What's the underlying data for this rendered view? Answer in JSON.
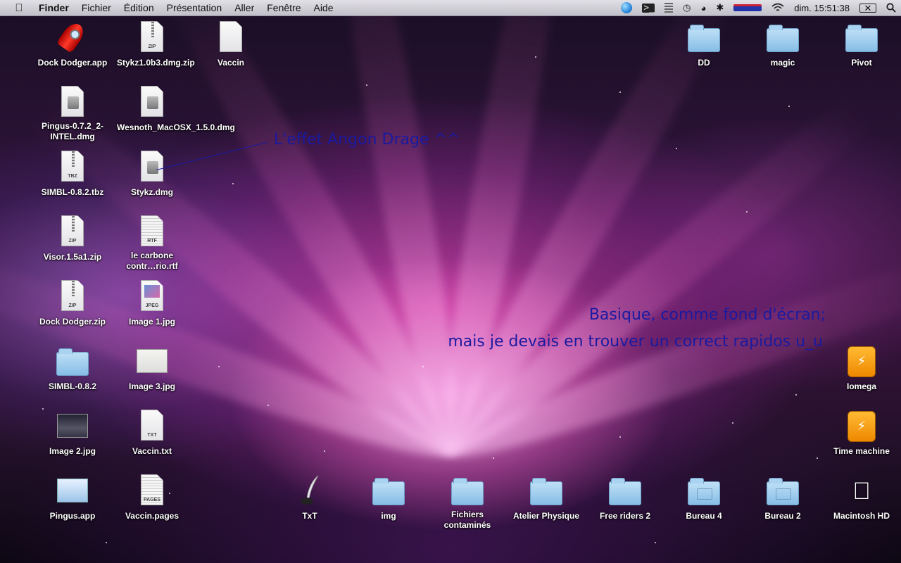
{
  "menubar": {
    "app": "Finder",
    "menus": [
      "Fichier",
      "Édition",
      "Présentation",
      "Aller",
      "Fenêtre",
      "Aide"
    ],
    "clock": "dim. 15:51:38",
    "icons": [
      "globe-icon",
      "terminal-icon",
      "bars-icon",
      "time-machine-icon",
      "palette-icon",
      "bluetooth-icon",
      "flag-icon",
      "wifi-icon",
      "battery-icon",
      "spotlight-icon"
    ]
  },
  "icons": {
    "dock_dodger_app": "Dock Dodger.app",
    "stykz_zip": "Stykz1.0b3.dmg.zip",
    "vaccin": "Vaccin",
    "pingus_dmg": "Pingus-0.7.2_2-INTEL.dmg",
    "wesnoth_dmg": "Wesnoth_MacOSX_1.5.0.dmg",
    "simbl_tbz": "SIMBL-0.8.2.tbz",
    "stykz_dmg": "Stykz.dmg",
    "visor_zip": "Visor.1.5a1.zip",
    "carbone_rtf": "le carbone contr…rio.rtf",
    "dock_dodger_zip": "Dock Dodger.zip",
    "image1": "Image 1.jpg",
    "simbl_folder": "SIMBL-0.8.2",
    "image3": "Image 3.jpg",
    "image2": "Image 2.jpg",
    "vaccin_txt": "Vaccin.txt",
    "pingus_app": "Pingus.app",
    "vaccin_pages": "Vaccin.pages",
    "dd": "DD",
    "magic": "magic",
    "pivot": "Pivot",
    "iomega": "Iomega",
    "time_machine": "Time machine",
    "macintosh_hd": "Macintosh HD",
    "txt": "TxT",
    "img": "img",
    "fichiers": "Fichiers contaminés",
    "atelier": "Atelier Physique",
    "free_riders": "Free riders 2",
    "bureau4": "Bureau 4",
    "bureau2": "Bureau 2"
  },
  "annotations": {
    "angon": "L'effet Angon Drage ^^",
    "basique": "Basique, comme fond d'écran;",
    "rapidos": "mais je devais en trouver un correct rapidos u_u"
  },
  "doc_tags": {
    "zip": "ZIP",
    "tbz": "TBZ",
    "rtf": "RTF",
    "jpeg": "JPEG",
    "txt": "TXT",
    "pages": "PAGES"
  },
  "colors": {
    "annotation": "#1a1aa0",
    "folder": "#9ccbee"
  }
}
